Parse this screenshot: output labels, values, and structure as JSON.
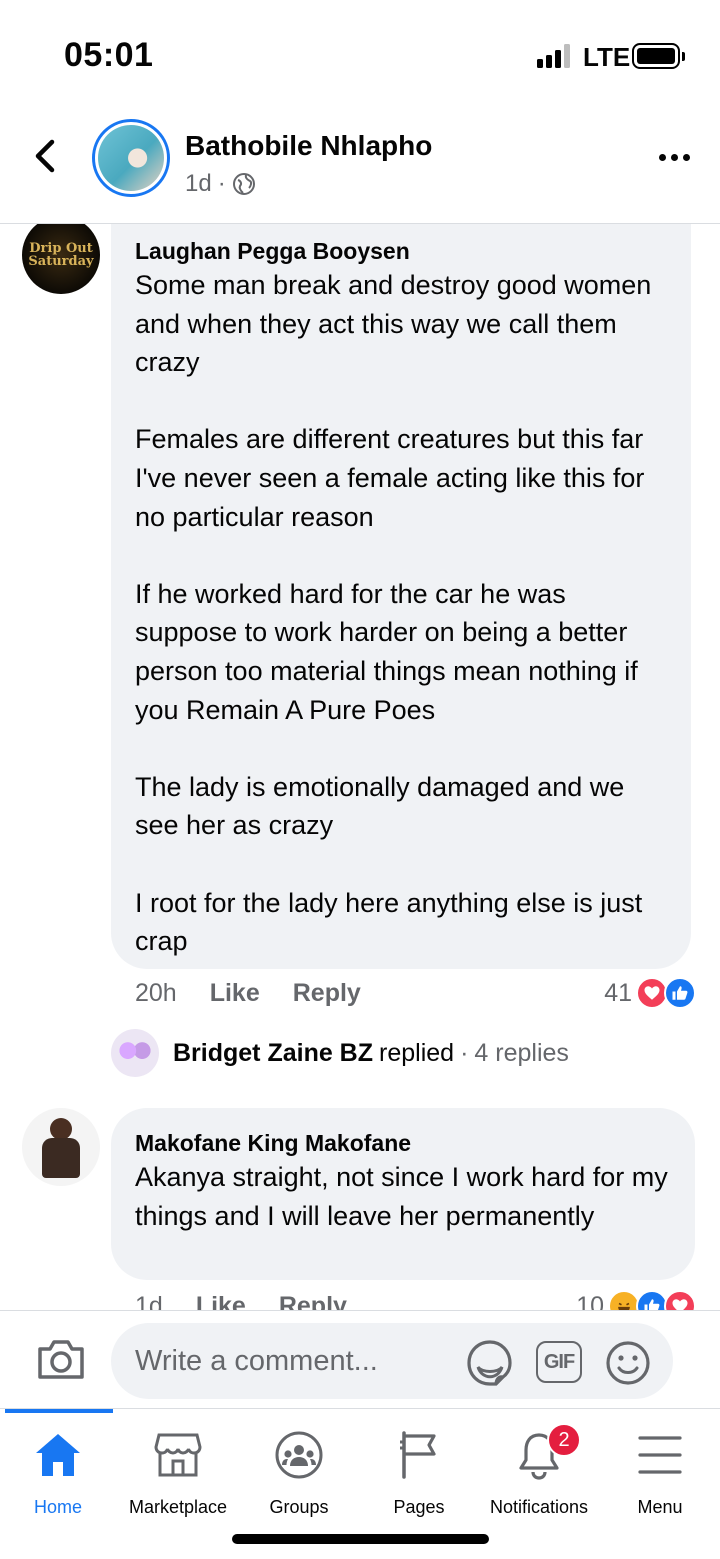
{
  "status_bar": {
    "time": "05:01",
    "network": "LTE"
  },
  "header": {
    "name": "Bathobile Nhlapho",
    "time": "1d",
    "separator": "·",
    "privacy_icon": "globe-icon"
  },
  "comments": [
    {
      "author": "Laughan Pegga Booysen",
      "avatar_text": "Drip Out Saturday",
      "text": "Some man break and destroy good women and when they act this way we call them crazy\n\nFemales are different creatures but this far I've never seen a female acting like this for no particular reason\n\nIf he worked hard for the car he was suppose to work harder on being a better person too material things mean nothing if you Remain A Pure Poes\n\nThe lady is emotionally damaged and we see her as crazy\n\nI root for the lady here anything else is just crap",
      "time": "20h",
      "like_label": "Like",
      "reply_label": "Reply",
      "reaction_count": "41",
      "reactions": [
        "love",
        "like"
      ]
    },
    {
      "author": "Makofane King Makofane",
      "text": "Akanya straight, not since I work hard for my things and I will leave her permanently",
      "time": "1d",
      "like_label": "Like",
      "reply_label": "Reply",
      "reaction_count": "10",
      "reactions": [
        "haha",
        "like",
        "love"
      ]
    }
  ],
  "replies_preview": {
    "name": "Bridget Zaine BZ",
    "action": "replied",
    "separator": "·",
    "count": "4 replies"
  },
  "composer": {
    "placeholder": "Write a comment...",
    "gif_label": "GIF"
  },
  "nav": {
    "items": [
      {
        "label": "Home",
        "icon": "home-icon",
        "active": true
      },
      {
        "label": "Marketplace",
        "icon": "marketplace-icon"
      },
      {
        "label": "Groups",
        "icon": "groups-icon"
      },
      {
        "label": "Pages",
        "icon": "flag-icon"
      },
      {
        "label": "Notifications",
        "icon": "bell-icon",
        "badge": "2"
      },
      {
        "label": "Menu",
        "icon": "menu-icon"
      }
    ]
  },
  "colors": {
    "accent": "#1877f2",
    "bubble": "#f0f2f5",
    "secondary_text": "#65676b",
    "badge": "#e41e3f"
  }
}
